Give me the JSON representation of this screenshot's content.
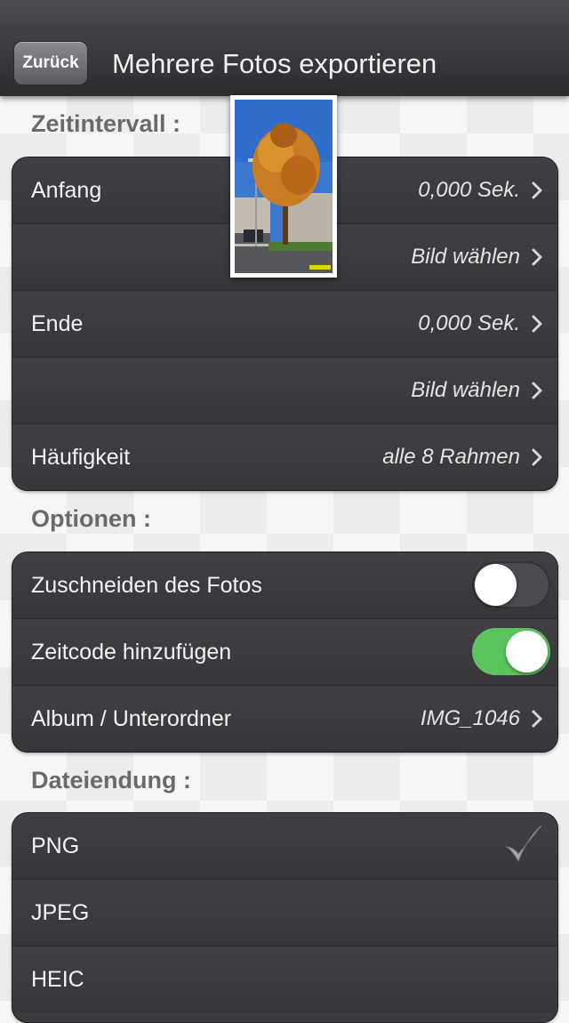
{
  "nav": {
    "back_label": "Zurück",
    "title": "Mehrere Fotos exportieren"
  },
  "sections": {
    "interval_header": "Zeitintervall :",
    "options_header": "Optionen :",
    "extension_header": "Dateiendung :"
  },
  "interval": {
    "start_label": "Anfang",
    "start_value": "0,000 Sek.",
    "start_pick": "Bild wählen",
    "end_label": "Ende",
    "end_value": "0,000 Sek.",
    "end_pick": "Bild wählen",
    "frequency_label": "Häufigkeit",
    "frequency_value": "alle 8 Rahmen"
  },
  "options": {
    "crop_label": "Zuschneiden des Fotos",
    "crop_enabled": false,
    "timecode_label": "Zeitcode hinzufügen",
    "timecode_enabled": true,
    "album_label": "Album / Unterordner",
    "album_value": "IMG_1046"
  },
  "extension": {
    "options": [
      "PNG",
      "JPEG",
      "HEIC"
    ],
    "selected": "PNG"
  },
  "icons": {
    "chevron": "chevron-right-icon",
    "check": "checkmark-icon"
  },
  "colors": {
    "toggle_on": "#5bc45e",
    "group_bg": "#3c3c40",
    "section_text": "#6a6a6a"
  }
}
